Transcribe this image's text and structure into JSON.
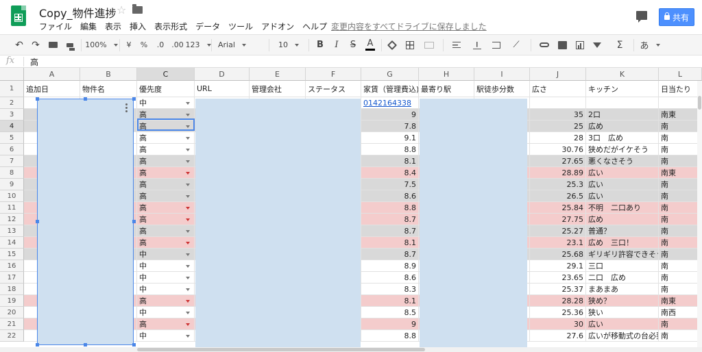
{
  "header": {
    "title": "Copy_物件進捗",
    "menu": [
      "ファイル",
      "編集",
      "表示",
      "挿入",
      "表示形式",
      "データ",
      "ツール",
      "アドオン",
      "ヘルプ"
    ],
    "save_status": "変更内容をすべてドライブに保存しました",
    "share_label": "共有"
  },
  "toolbar": {
    "zoom": "100%",
    "currency": "¥",
    "percent": "%",
    "dec_less": ".0",
    "dec_more": ".00",
    "more_formats": "123",
    "font": "Arial",
    "font_size": "10",
    "bold": "B",
    "italic": "I",
    "strike": "S",
    "text_color": "A",
    "input_tools": "あ"
  },
  "formula_bar": {
    "fx": "fx",
    "value": "高"
  },
  "grid": {
    "columns": [
      "A",
      "B",
      "C",
      "D",
      "E",
      "F",
      "G",
      "H",
      "I",
      "J",
      "K",
      "L"
    ],
    "header_row": [
      "追加日",
      "物件名",
      "優先度",
      "URL",
      "管理会社",
      "ステータス",
      "家賃（管理費込)",
      "最寄り駅",
      "駅徒歩分数",
      "広さ",
      "キッチン",
      "日当たり"
    ],
    "row_numbers": [
      "1",
      "2",
      "3",
      "4",
      "5",
      "6",
      "7",
      "8",
      "9",
      "10",
      "11",
      "12",
      "13",
      "14",
      "15",
      "16",
      "17",
      "18",
      "19",
      "20",
      "21",
      "22"
    ],
    "rows": [
      {
        "priority": "中",
        "rent": "",
        "size": "",
        "kitchen": "",
        "sun": "",
        "tone": "white",
        "link": "0142164338"
      },
      {
        "priority": "高",
        "rent": "9",
        "size": "35",
        "kitchen": "2口",
        "sun": "南東",
        "tone": "gray"
      },
      {
        "priority": "高",
        "rent": "7.8",
        "size": "25",
        "kitchen": "広め",
        "sun": "南",
        "tone": "gray"
      },
      {
        "priority": "高",
        "rent": "9.1",
        "size": "28",
        "kitchen": "3口　広め",
        "sun": "南",
        "tone": "white"
      },
      {
        "priority": "高",
        "rent": "8.8",
        "size": "30.76",
        "kitchen": "狭めだがイケそう",
        "sun": "南",
        "tone": "white"
      },
      {
        "priority": "高",
        "rent": "8.1",
        "size": "27.65",
        "kitchen": "悪くなさそう",
        "sun": "南",
        "tone": "gray"
      },
      {
        "priority": "高",
        "rent": "8.4",
        "size": "28.89",
        "kitchen": "広い",
        "sun": "南東",
        "tone": "pink"
      },
      {
        "priority": "高",
        "rent": "7.5",
        "size": "25.3",
        "kitchen": "広い",
        "sun": "南",
        "tone": "gray"
      },
      {
        "priority": "高",
        "rent": "8.6",
        "size": "26.5",
        "kitchen": "広い",
        "sun": "南",
        "tone": "gray"
      },
      {
        "priority": "高",
        "rent": "8.8",
        "size": "25.84",
        "kitchen": "不明　二口あり",
        "sun": "南",
        "tone": "pink"
      },
      {
        "priority": "高",
        "rent": "8.7",
        "size": "27.75",
        "kitchen": "広め",
        "sun": "南",
        "tone": "pink"
      },
      {
        "priority": "高",
        "rent": "8.7",
        "size": "25.27",
        "kitchen": "普通？",
        "sun": "南",
        "tone": "gray"
      },
      {
        "priority": "高",
        "rent": "8.1",
        "size": "23.1",
        "kitchen": "広め　三口！",
        "sun": "南",
        "tone": "pink"
      },
      {
        "priority": "中",
        "rent": "8.7",
        "size": "25.68",
        "kitchen": "ギリギリ許容できそう",
        "sun": "南",
        "tone": "gray"
      },
      {
        "priority": "中",
        "rent": "8.9",
        "size": "29.1",
        "kitchen": "三口",
        "sun": "南",
        "tone": "white"
      },
      {
        "priority": "中",
        "rent": "8.6",
        "size": "23.65",
        "kitchen": "二口　広め",
        "sun": "南",
        "tone": "white"
      },
      {
        "priority": "中",
        "rent": "8.3",
        "size": "25.37",
        "kitchen": "まあまあ",
        "sun": "南",
        "tone": "white"
      },
      {
        "priority": "高",
        "rent": "8.1",
        "size": "28.28",
        "kitchen": "狭め？",
        "sun": "南東",
        "tone": "pink"
      },
      {
        "priority": "中",
        "rent": "8.5",
        "size": "25.36",
        "kitchen": "狭い",
        "sun": "南西",
        "tone": "white"
      },
      {
        "priority": "高",
        "rent": "9",
        "size": "30",
        "kitchen": "広い",
        "sun": "南",
        "tone": "pink"
      },
      {
        "priority": "中",
        "rent": "8.8",
        "size": "27.6",
        "kitchen": "広いが移動式の台必要",
        "sun": "南",
        "tone": "white"
      }
    ]
  },
  "colors": {
    "gray": "#d9d9d9",
    "pink": "#f4cccc",
    "white": "#ffffff",
    "selection": "#4a86e8",
    "redaction": "#cfe0f0"
  }
}
